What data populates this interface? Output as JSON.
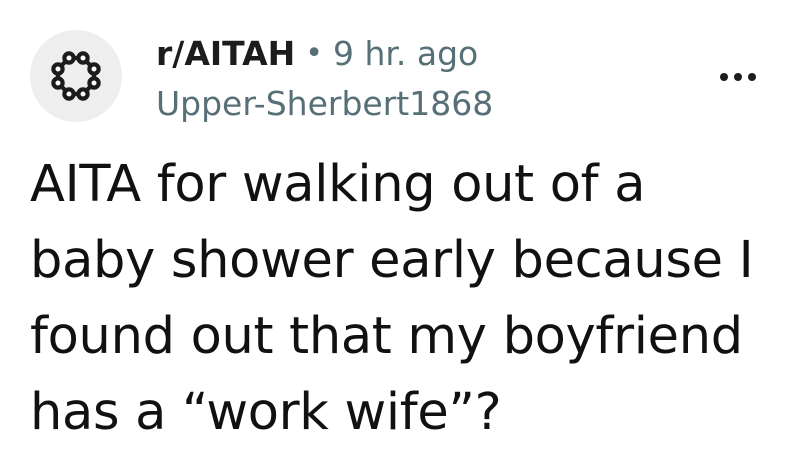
{
  "post": {
    "subreddit": "r/AITAH",
    "separator": "•",
    "age": "9 hr. ago",
    "author": "Upper-Sherbert1868",
    "title_lines": [
      "AITA for walking out of a",
      "baby shower early because I",
      "found out that my boyfriend",
      "has a “work wife”?"
    ]
  },
  "icons": {
    "avatar": "snoo-ring-icon",
    "overflow": "more-options-icon"
  },
  "colors": {
    "text_primary": "#1c1c1c",
    "text_meta": "#576f76",
    "avatar_bg": "#eeeeee",
    "background": "#ffffff"
  }
}
